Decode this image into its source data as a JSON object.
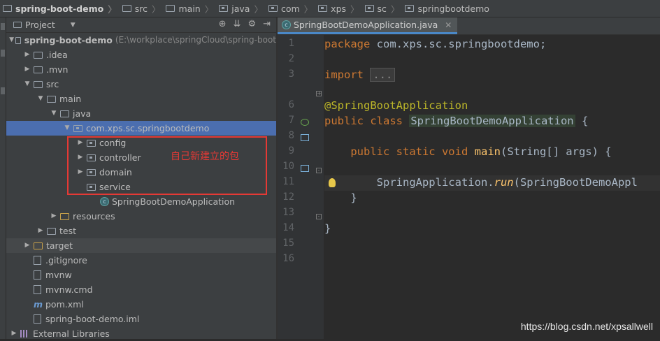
{
  "breadcrumb": [
    "spring-boot-demo",
    "src",
    "main",
    "java",
    "com",
    "xps",
    "sc",
    "springbootdemo"
  ],
  "project_panel": {
    "title": "Project",
    "tree": [
      {
        "label": "spring-boot-demo",
        "extra": "(E:\\workplace\\springCloud\\spring-boot",
        "indent": 0,
        "arrow": "down",
        "icon": "folder-module",
        "bold": true
      },
      {
        "label": ".idea",
        "indent": 1,
        "arrow": "right",
        "icon": "folder"
      },
      {
        "label": ".mvn",
        "indent": 1,
        "arrow": "right",
        "icon": "folder"
      },
      {
        "label": "src",
        "indent": 1,
        "arrow": "down",
        "icon": "folder"
      },
      {
        "label": "main",
        "indent": 2,
        "arrow": "down",
        "icon": "folder"
      },
      {
        "label": "java",
        "indent": 3,
        "arrow": "down",
        "icon": "folder-source"
      },
      {
        "label": "com.xps.sc.springbootdemo",
        "indent": 4,
        "arrow": "down",
        "icon": "package",
        "selected": true
      },
      {
        "label": "config",
        "indent": 5,
        "arrow": "right",
        "icon": "package"
      },
      {
        "label": "controller",
        "indent": 5,
        "arrow": "right",
        "icon": "package"
      },
      {
        "label": "domain",
        "indent": 5,
        "arrow": "right",
        "icon": "package"
      },
      {
        "label": "service",
        "indent": 5,
        "arrow": "",
        "icon": "package"
      },
      {
        "label": "SpringBootDemoApplication",
        "indent": 6,
        "arrow": "",
        "icon": "spring-class"
      },
      {
        "label": "resources",
        "indent": 3,
        "arrow": "right",
        "icon": "folder-resources"
      },
      {
        "label": "test",
        "indent": 2,
        "arrow": "right",
        "icon": "folder"
      },
      {
        "label": "target",
        "indent": 1,
        "arrow": "right",
        "icon": "folder-orange",
        "highlight": true
      },
      {
        "label": ".gitignore",
        "indent": 1,
        "arrow": "",
        "icon": "file"
      },
      {
        "label": "mvnw",
        "indent": 1,
        "arrow": "",
        "icon": "file"
      },
      {
        "label": "mvnw.cmd",
        "indent": 1,
        "arrow": "",
        "icon": "file"
      },
      {
        "label": "pom.xml",
        "indent": 1,
        "arrow": "",
        "icon": "maven-file"
      },
      {
        "label": "spring-boot-demo.iml",
        "indent": 1,
        "arrow": "",
        "icon": "file"
      },
      {
        "label": "External Libraries",
        "indent": 0,
        "arrow": "right",
        "icon": "library"
      }
    ],
    "annotation": "自己新建立的包"
  },
  "editor": {
    "tab_label": "SpringBootDemoApplication.java",
    "line_numbers": [
      "1",
      "2",
      "3",
      "6",
      "7",
      "8",
      "9",
      "10",
      "11",
      "12",
      "13",
      "14",
      "15",
      "16"
    ],
    "code": {
      "l1_kw": "package",
      "l1_rest": " com.xps.sc.springbootdemo;",
      "l3_kw": "import",
      "l3_fold": "...",
      "l6_ann": "@SpringBootApplication",
      "l7_kw": "public class",
      "l7_cls": "SpringBootDemoApplication",
      "l7_rest": " {",
      "l9_kw": "public static void",
      "l9_fn": "main",
      "l9_rest": "(String[] args) {",
      "l11_a": "SpringApplication.",
      "l11_run": "run",
      "l11_b": "(SpringBootDemoAppl",
      "l12": "}",
      "l14": "}"
    }
  },
  "watermark": "https://blog.csdn.net/xpsallwell"
}
